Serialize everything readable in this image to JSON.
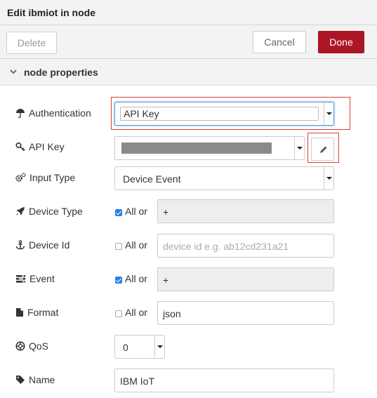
{
  "dialog": {
    "title": "Edit ibmiot in node",
    "delete_label": "Delete",
    "cancel_label": "Cancel",
    "done_label": "Done",
    "accent_color": "#ad1625"
  },
  "section": {
    "title": "node properties"
  },
  "fields": {
    "authentication": {
      "label": "Authentication",
      "value": "API Key"
    },
    "api_key": {
      "label": "API Key",
      "value": ""
    },
    "input_type": {
      "label": "Input Type",
      "value": "Device Event"
    },
    "device_type": {
      "label": "Device Type",
      "all_label": "All or",
      "checked": true,
      "value": "+"
    },
    "device_id": {
      "label": "Device Id",
      "all_label": "All or",
      "checked": false,
      "placeholder": "device id e.g. ab12cd231a21"
    },
    "event": {
      "label": "Event",
      "all_label": "All or",
      "checked": true,
      "value": "+"
    },
    "format": {
      "label": "Format",
      "all_label": "All or",
      "checked": false,
      "value": "json"
    },
    "qos": {
      "label": "QoS",
      "value": "0"
    },
    "name": {
      "label": "Name",
      "value": "IBM IoT"
    }
  },
  "icons": {
    "authentication": "umbrella-icon",
    "api_key": "key-icon",
    "input_type": "cogs-icon",
    "device_type": "rocket-icon",
    "device_id": "anchor-icon",
    "event": "tasks-icon",
    "format": "file-icon",
    "qos": "life-ring-icon",
    "name": "tag-icon",
    "edit": "pencil-icon"
  }
}
